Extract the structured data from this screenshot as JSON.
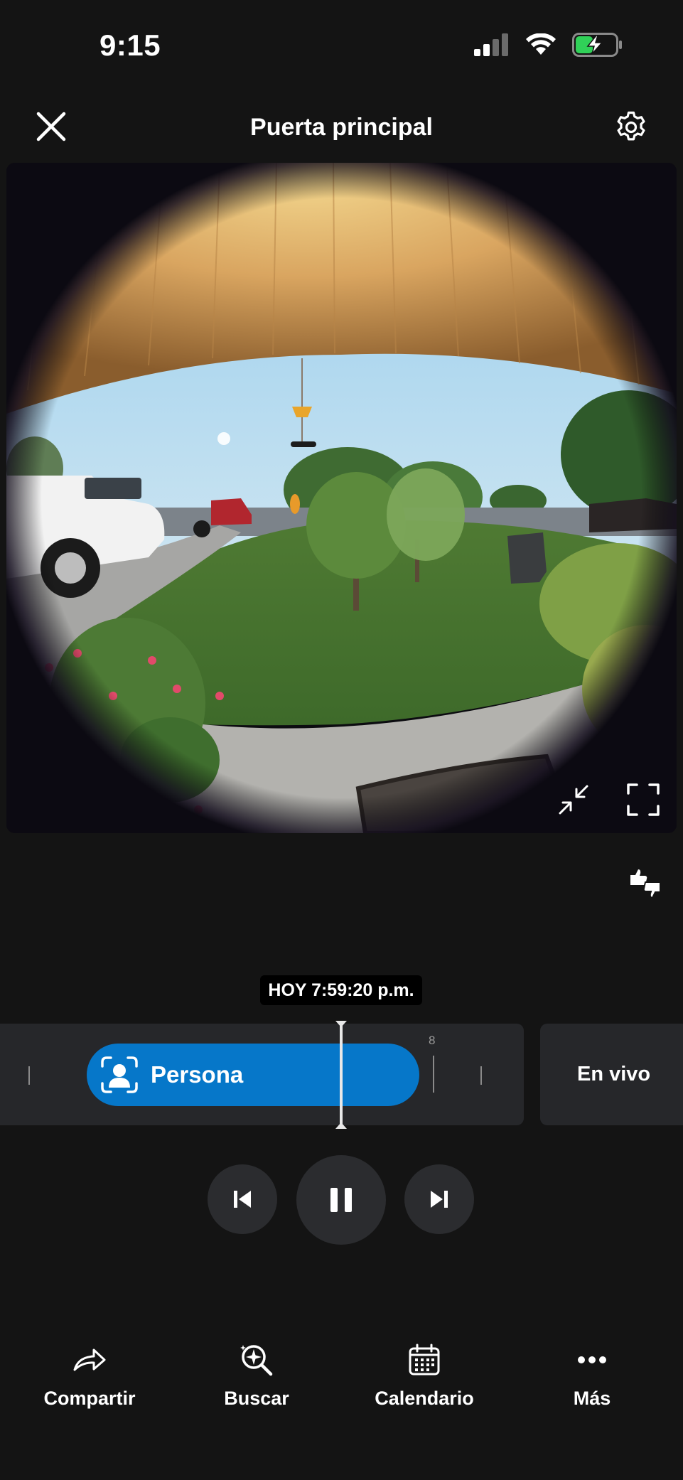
{
  "status_bar": {
    "time": "9:15",
    "icons": [
      "cellular-signal-icon",
      "wifi-icon",
      "battery-charging-icon"
    ]
  },
  "header": {
    "title": "Puerta principal",
    "close_icon": "close-icon",
    "settings_icon": "gear-icon"
  },
  "video": {
    "controls": [
      "minimize-icon",
      "fullscreen-icon"
    ]
  },
  "feedback": {
    "icon": "thumbs-up-down-icon"
  },
  "timeline": {
    "timestamp": "HOY 7:59:20 p.m.",
    "event_label": "Persona",
    "event_icon": "person-detection-icon",
    "tick_count": "8",
    "live_label": "En vivo",
    "colors": {
      "event": "#0677c9",
      "track": "#26272a"
    }
  },
  "playback": {
    "buttons": [
      "previous-icon",
      "pause-icon",
      "next-icon"
    ]
  },
  "bottom_nav": {
    "items": [
      {
        "label": "Compartir",
        "icon": "share-icon"
      },
      {
        "label": "Buscar",
        "icon": "smart-search-icon"
      },
      {
        "label": "Calendario",
        "icon": "calendar-icon"
      },
      {
        "label": "Más",
        "icon": "more-icon"
      }
    ]
  }
}
